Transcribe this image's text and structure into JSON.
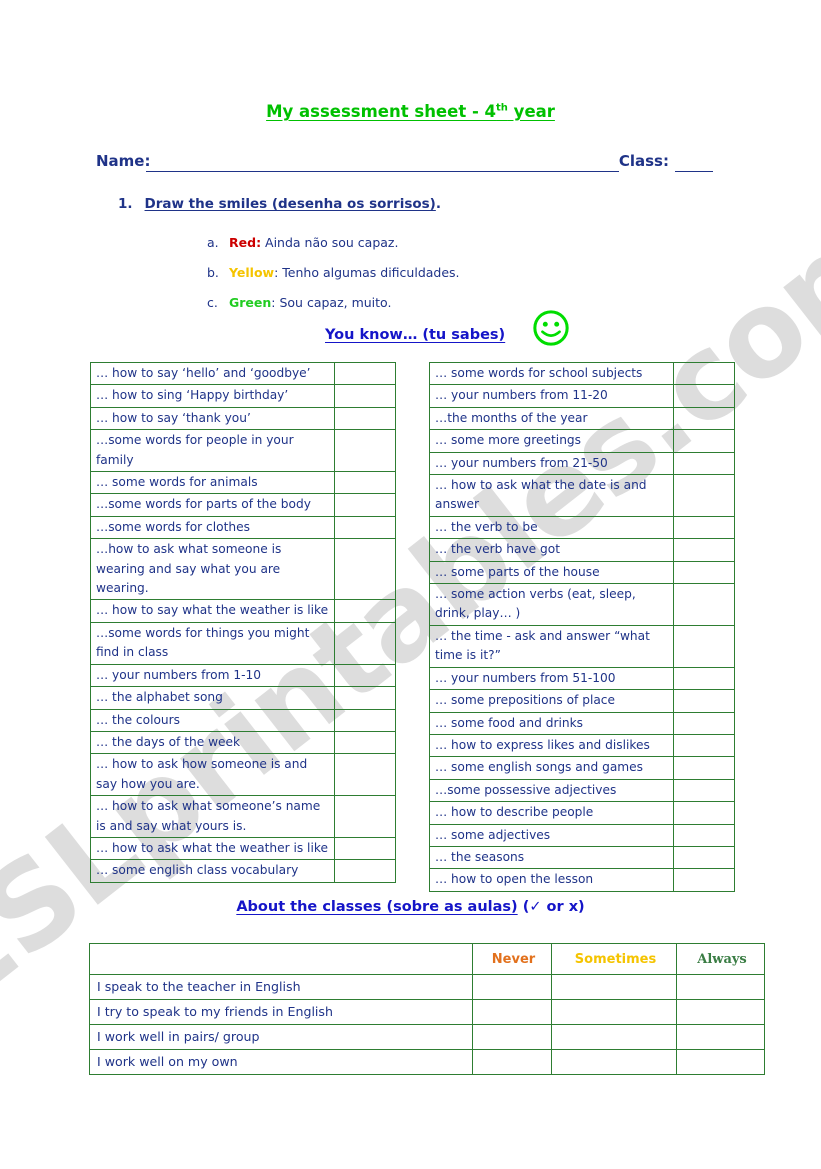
{
  "watermark": "ESLprintables.com",
  "title": {
    "main": "My assessment sheet - 4",
    "sup": "th",
    "suffix": " year"
  },
  "header": {
    "name_label": "Name:",
    "class_label": "Class:"
  },
  "instruction": {
    "number": "1.",
    "text": "Draw the smiles (desenha os sorrisos)",
    "period": "."
  },
  "legend": {
    "items": [
      {
        "marker": "a.",
        "key": "Red",
        "sep": ":",
        "text": " Ainda não sou capaz.",
        "color": "#CC0000"
      },
      {
        "marker": "b.",
        "key": "Yellow",
        "sep": ":",
        "text": " Tenho algumas dificuldades.",
        "color": "#F5C400"
      },
      {
        "marker": "c.",
        "key": "Green",
        "sep": ":",
        "text": " Sou capaz, muito.",
        "color": "#22CC22"
      }
    ]
  },
  "you_know": {
    "heading": "You know…  (tu sabes)",
    "smiley_color": "#00DD00"
  },
  "know_left": [
    "… how to say ‘hello’ and ‘goodbye’",
    "… how to sing ‘Happy birthday’",
    "… how to say ‘thank you’",
    "…some words for people in your family",
    "… some words for animals",
    "…some words for parts of the body",
    "…some words for clothes",
    "…how to ask what someone is wearing and say what you are wearing.",
    "… how to say what the weather is like",
    "…some words for things you might find in class",
    "… your numbers from 1-10",
    "… the alphabet song",
    "… the colours",
    "… the days of the week",
    "… how to ask how someone is and say how you are.",
    "… how to ask what someone’s name is and say what yours is.",
    "… how to ask what the weather is like",
    "… some english class vocabulary"
  ],
  "know_right": [
    "… some words for school subjects",
    "… your numbers from 11-20",
    "…the months of the year",
    "… some more greetings",
    "… your numbers from 21-50",
    "… how to ask what the date is and answer",
    "… the verb to be",
    "… the verb have got",
    "… some parts of the house",
    "… some action verbs (eat, sleep, drink, play… )",
    "… the time - ask and answer “what time is it?”",
    "… your numbers from 51-100",
    "… some prepositions of place",
    "… some food and drinks",
    "… how to express likes and dislikes",
    "… some english songs and games",
    "…some possessive adjectives",
    "… how to describe people",
    "… some adjectives",
    "… the seasons",
    "… how to open the lesson"
  ],
  "about": {
    "heading": "About the classes (sobre as aulas)",
    "tail": " (✓ or x)"
  },
  "classes": {
    "headers": [
      {
        "label": "",
        "color": ""
      },
      {
        "label": "Never",
        "color": "#E2711D"
      },
      {
        "label": "Sometimes",
        "color": "#F5C400"
      },
      {
        "label": "Always",
        "color": "#3A7D44"
      }
    ],
    "rows": [
      "I speak to the teacher in English",
      "I try to speak to my friends in English",
      "I work well in pairs/ group",
      "I work well on my own"
    ]
  }
}
